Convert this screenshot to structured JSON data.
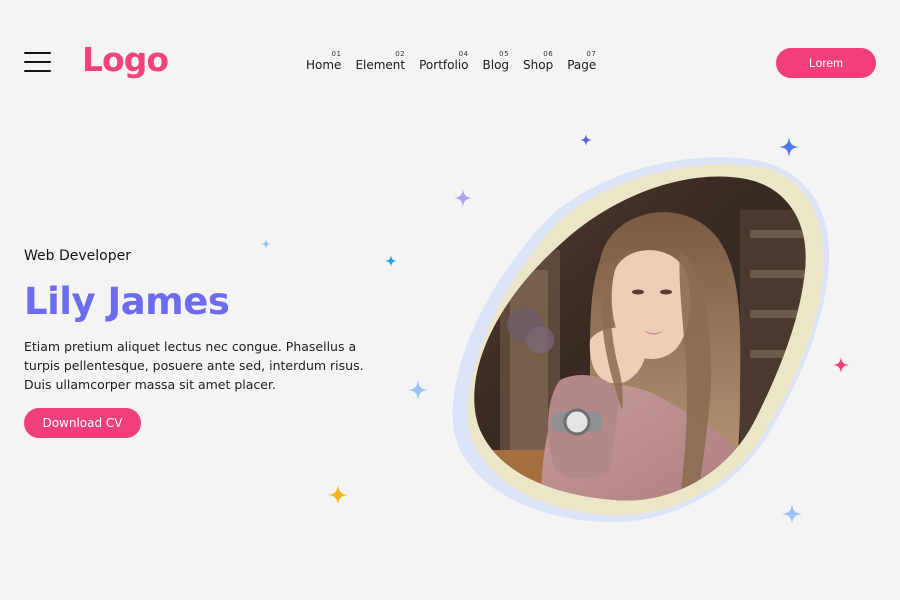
{
  "header": {
    "logo_text": "Logo",
    "nav": [
      {
        "num": "01",
        "label": "Home"
      },
      {
        "num": "02",
        "label": "Element"
      },
      {
        "num": "04",
        "label": "Portfolio"
      },
      {
        "num": "05",
        "label": "Blog"
      },
      {
        "num": "06",
        "label": "Shop"
      },
      {
        "num": "07",
        "label": "Page"
      }
    ],
    "cta_label": "Lorem"
  },
  "hero": {
    "subtitle": "Web Developer",
    "name": "Lily James",
    "description_lines": [
      "Etiam pretium aliquet lectus nec congue. Phasellus a",
      "turpis pellentesque, posuere ante sed, interdum risus.",
      "Duis ullamcorper massa sit amet placer."
    ],
    "download_label": "Download CV"
  },
  "colors": {
    "accent_pink": "#f23f7a",
    "headline_purple": "#6d6cf1",
    "background": "#f4f4f4",
    "sparkle_blue": "#4b7be6",
    "sparkle_purple": "#a9a4f3",
    "sparkle_light_blue": "#9cc3f5",
    "sparkle_cyan": "#1aa3e8",
    "sparkle_yellow": "#f7b51b",
    "sparkle_pink": "#ee3f7a",
    "sparkle_navy": "#5a63d8",
    "blob_yellow": "#ece6c9",
    "blob_blue": "#d9e1f7"
  },
  "icons": {
    "menu": "hamburger-menu-icon",
    "sparkle": "sparkle-star-icon"
  }
}
